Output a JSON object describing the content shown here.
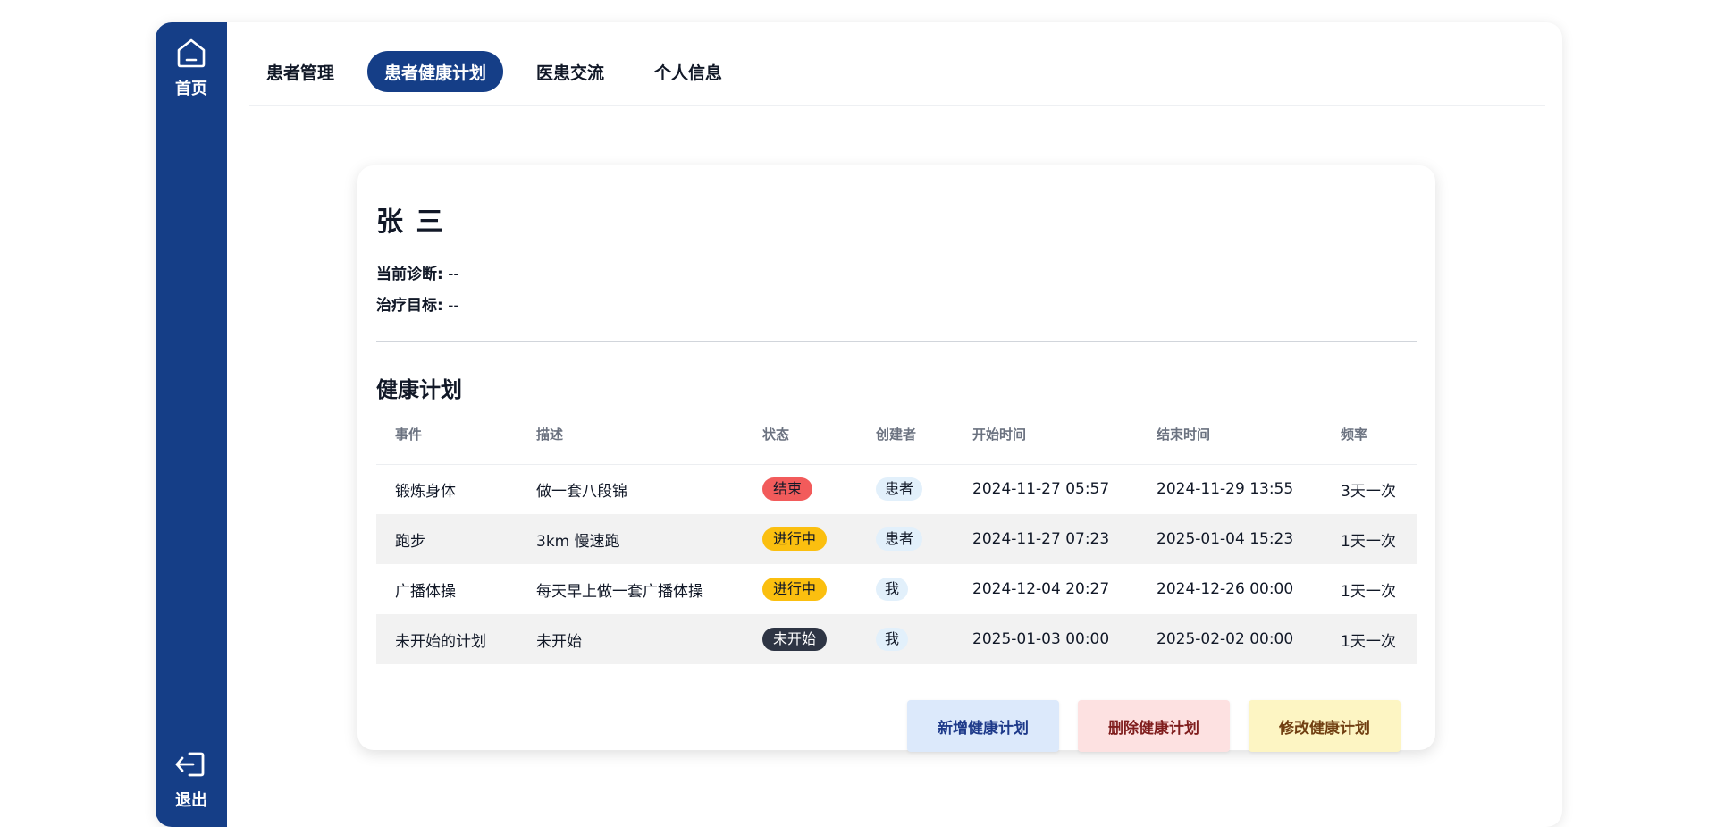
{
  "sidebar": {
    "home_label": "首页",
    "logout_label": "退出",
    "home_icon": "home-icon",
    "logout_icon": "logout-icon"
  },
  "nav": {
    "items": [
      {
        "label": "患者管理",
        "active": false
      },
      {
        "label": "患者健康计划",
        "active": true
      },
      {
        "label": "医患交流",
        "active": false
      },
      {
        "label": "个人信息",
        "active": false
      }
    ]
  },
  "patient": {
    "name": "张 三",
    "diagnosis_label": "当前诊断:",
    "diagnosis_value": "--",
    "goal_label": "治疗目标:",
    "goal_value": "--"
  },
  "plans": {
    "title": "健康计划",
    "headers": [
      "事件",
      "描述",
      "状态",
      "创建者",
      "开始时间",
      "结束时间",
      "频率"
    ],
    "rows": [
      {
        "event": "锻炼身体",
        "desc": "做一套八段锦",
        "status": "结束",
        "creator": "患者",
        "start": "2024-11-27 05:57",
        "end": "2024-11-29 13:55",
        "freq": "3天一次"
      },
      {
        "event": "跑步",
        "desc": "3km 慢速跑",
        "status": "进行中",
        "creator": "患者",
        "start": "2024-11-27 07:23",
        "end": "2025-01-04 15:23",
        "freq": "1天一次"
      },
      {
        "event": "广播体操",
        "desc": "每天早上做一套广播体操",
        "status": "进行中",
        "creator": "我",
        "start": "2024-12-04 20:27",
        "end": "2024-12-26 00:00",
        "freq": "1天一次"
      },
      {
        "event": "未开始的计划",
        "desc": "未开始",
        "status": "未开始",
        "creator": "我",
        "start": "2025-01-03 00:00",
        "end": "2025-02-02 00:00",
        "freq": "1天一次"
      }
    ]
  },
  "actions": {
    "add_label": "新增健康计划",
    "delete_label": "删除健康计划",
    "edit_label": "修改健康计划"
  },
  "colors": {
    "brand": "#153e87",
    "status_ended": "#f25b5b",
    "status_in_progress": "#fbbf0f",
    "status_not_started": "#2e3544"
  }
}
